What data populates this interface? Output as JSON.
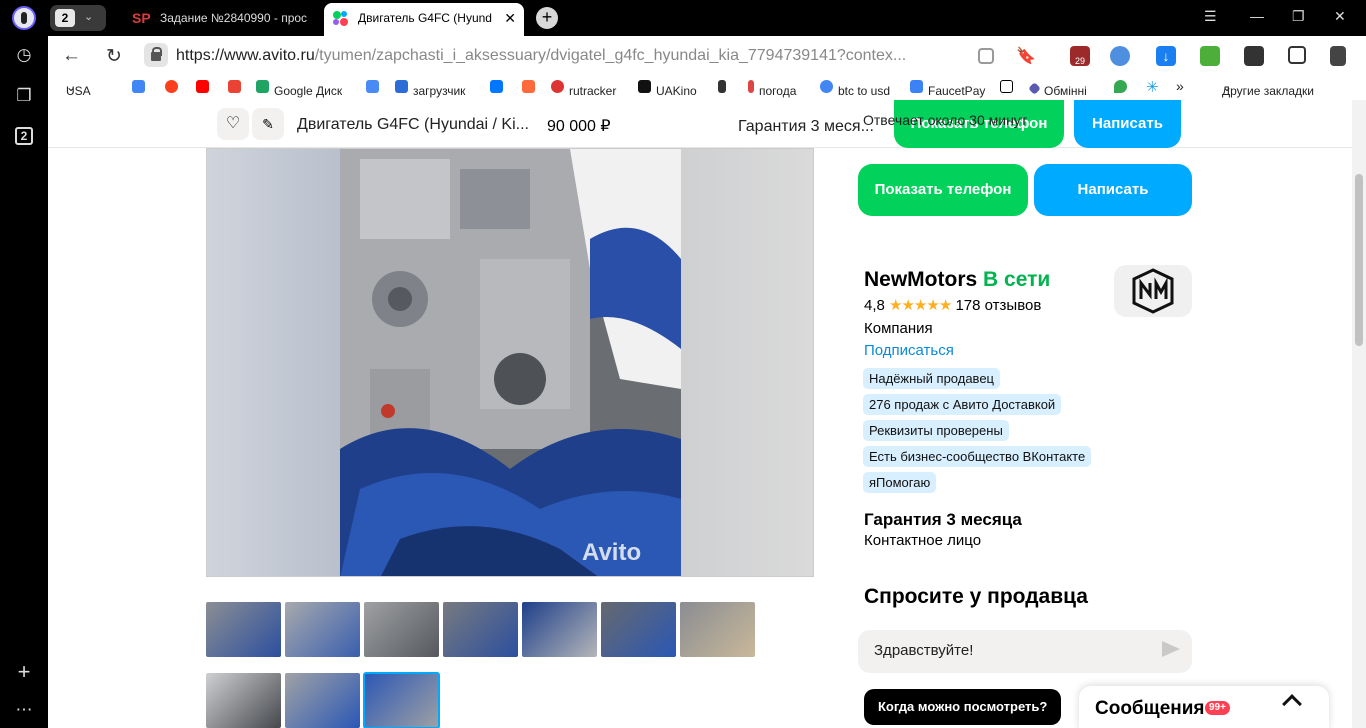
{
  "browser": {
    "tab_group_count": "2",
    "tabs": [
      {
        "label": "Задание №2840990 - прос"
      },
      {
        "label": "Двигатель G4FC (Hyund"
      }
    ],
    "sidebar_box_count": "2",
    "url_host": "https://www.avito.ru",
    "url_path": "/tyumen/zapchasti_i_aksessuary/dvigatel_g4fc_hyundai_kia_7794739141?contex...",
    "ext_badge": "29",
    "bookmarks": [
      "USA",
      "Google Диск",
      "загрузчик",
      "rutracker",
      "UAKino",
      "погода",
      "btc to usd",
      "FaucetPay",
      "Обмінні",
      "Другие закладки"
    ]
  },
  "sticky": {
    "title": "Двигатель G4FC (Hyundai / Ki...",
    "price": "90 000 ₽",
    "guarantee": "Гарантия 3 меся...",
    "reply_time": "Отвечает около 30 минут",
    "show_phone": "Показать телефон",
    "write": "Написать"
  },
  "actions": {
    "show_phone": "Показать телефон",
    "write": "Написать"
  },
  "photo": {
    "watermark": "Avito",
    "thumbnail_count": 10,
    "selected_thumbnail": 10
  },
  "seller": {
    "name": "NewMotors",
    "online": "В сети",
    "rating": "4,8",
    "stars": "★★★★★",
    "reviews": "178 отзывов",
    "type": "Компания",
    "subscribe": "Подписаться",
    "badges": [
      "Надёжный продавец",
      "276 продаж с Авито Доставкой",
      "Реквизиты проверены",
      "Есть бизнес-сообщество ВКонтакте",
      "яПомогаю"
    ],
    "guarantee": "Гарантия 3 месяца",
    "contact": "Контактное лицо"
  },
  "ask": {
    "heading": "Спросите у продавца",
    "input_value": "Здравствуйте!",
    "chip": "Когда можно посмотреть?"
  },
  "messages": {
    "label": "Сообщения",
    "count": "99+"
  },
  "colors": {
    "green": "#02d15c",
    "blue": "#00aaff",
    "online": "#02b34f",
    "badge": "#d7efff",
    "link": "#0a8ad8"
  }
}
